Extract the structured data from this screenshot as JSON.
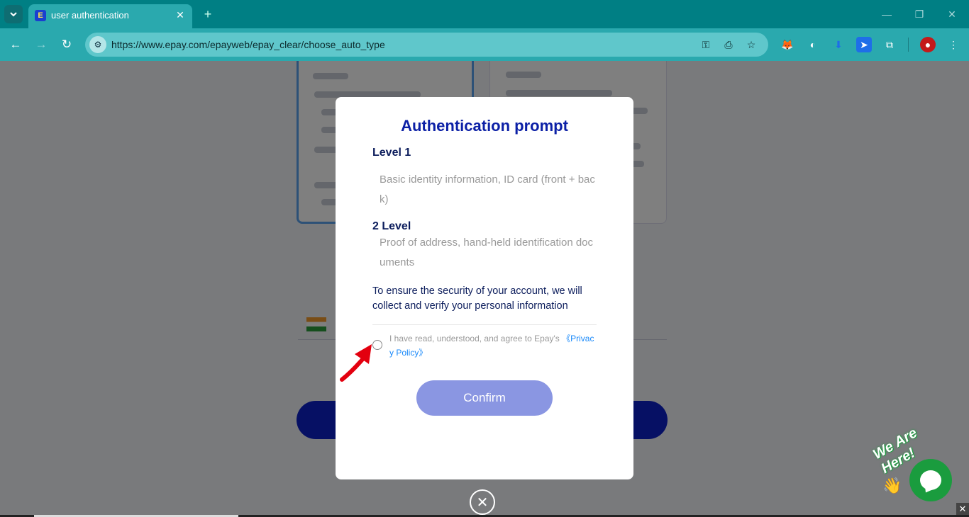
{
  "browser": {
    "tab_title": "user authentication",
    "url": "https://www.epay.com/epayweb/epay_clear/choose_auto_type"
  },
  "modal": {
    "title": "Authentication prompt",
    "level1_title": "Level 1",
    "level1_desc": "Basic identity information, ID card (front + back)",
    "level2_title": "2 Level",
    "level2_desc": "Proof of address, hand-held identification documents",
    "notice": "To ensure the security of your account, we will collect and verify your personal information",
    "agree_text": "I have read, understood, and agree to Epay's ",
    "privacy_link": "《Privacy Policy》",
    "confirm_label": "Confirm",
    "checkbox_checked": false
  },
  "chat_widget": {
    "badge_text": "We Are Here!"
  },
  "colors": {
    "chrome_dark": "#007f84",
    "chrome_light": "#2aa9ae",
    "title_blue": "#0c20a6",
    "confirm_bg": "#8a96e2",
    "link": "#1989fa",
    "chat_green": "#1a9c3e",
    "arrow_red": "#e3000f"
  }
}
